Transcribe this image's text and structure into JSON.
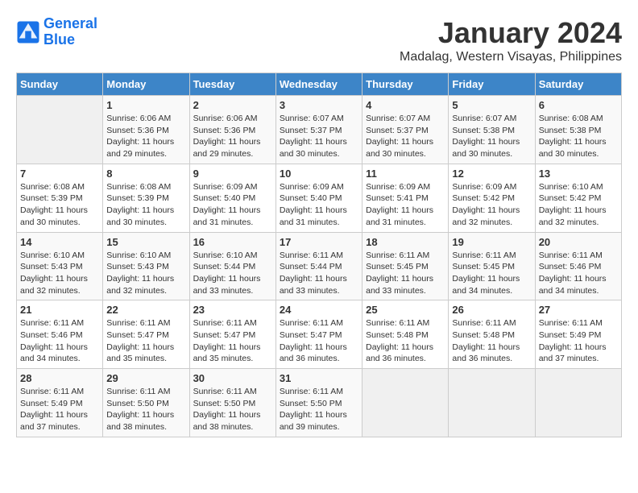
{
  "logo": {
    "line1": "General",
    "line2": "Blue"
  },
  "title": "January 2024",
  "subtitle": "Madalag, Western Visayas, Philippines",
  "days_header": [
    "Sunday",
    "Monday",
    "Tuesday",
    "Wednesday",
    "Thursday",
    "Friday",
    "Saturday"
  ],
  "weeks": [
    [
      {
        "day": "",
        "sunrise": "",
        "sunset": "",
        "daylight": ""
      },
      {
        "day": "1",
        "sunrise": "Sunrise: 6:06 AM",
        "sunset": "Sunset: 5:36 PM",
        "daylight": "Daylight: 11 hours and 29 minutes."
      },
      {
        "day": "2",
        "sunrise": "Sunrise: 6:06 AM",
        "sunset": "Sunset: 5:36 PM",
        "daylight": "Daylight: 11 hours and 29 minutes."
      },
      {
        "day": "3",
        "sunrise": "Sunrise: 6:07 AM",
        "sunset": "Sunset: 5:37 PM",
        "daylight": "Daylight: 11 hours and 30 minutes."
      },
      {
        "day": "4",
        "sunrise": "Sunrise: 6:07 AM",
        "sunset": "Sunset: 5:37 PM",
        "daylight": "Daylight: 11 hours and 30 minutes."
      },
      {
        "day": "5",
        "sunrise": "Sunrise: 6:07 AM",
        "sunset": "Sunset: 5:38 PM",
        "daylight": "Daylight: 11 hours and 30 minutes."
      },
      {
        "day": "6",
        "sunrise": "Sunrise: 6:08 AM",
        "sunset": "Sunset: 5:38 PM",
        "daylight": "Daylight: 11 hours and 30 minutes."
      }
    ],
    [
      {
        "day": "7",
        "sunrise": "Sunrise: 6:08 AM",
        "sunset": "Sunset: 5:39 PM",
        "daylight": "Daylight: 11 hours and 30 minutes."
      },
      {
        "day": "8",
        "sunrise": "Sunrise: 6:08 AM",
        "sunset": "Sunset: 5:39 PM",
        "daylight": "Daylight: 11 hours and 30 minutes."
      },
      {
        "day": "9",
        "sunrise": "Sunrise: 6:09 AM",
        "sunset": "Sunset: 5:40 PM",
        "daylight": "Daylight: 11 hours and 31 minutes."
      },
      {
        "day": "10",
        "sunrise": "Sunrise: 6:09 AM",
        "sunset": "Sunset: 5:40 PM",
        "daylight": "Daylight: 11 hours and 31 minutes."
      },
      {
        "day": "11",
        "sunrise": "Sunrise: 6:09 AM",
        "sunset": "Sunset: 5:41 PM",
        "daylight": "Daylight: 11 hours and 31 minutes."
      },
      {
        "day": "12",
        "sunrise": "Sunrise: 6:09 AM",
        "sunset": "Sunset: 5:42 PM",
        "daylight": "Daylight: 11 hours and 32 minutes."
      },
      {
        "day": "13",
        "sunrise": "Sunrise: 6:10 AM",
        "sunset": "Sunset: 5:42 PM",
        "daylight": "Daylight: 11 hours and 32 minutes."
      }
    ],
    [
      {
        "day": "14",
        "sunrise": "Sunrise: 6:10 AM",
        "sunset": "Sunset: 5:43 PM",
        "daylight": "Daylight: 11 hours and 32 minutes."
      },
      {
        "day": "15",
        "sunrise": "Sunrise: 6:10 AM",
        "sunset": "Sunset: 5:43 PM",
        "daylight": "Daylight: 11 hours and 32 minutes."
      },
      {
        "day": "16",
        "sunrise": "Sunrise: 6:10 AM",
        "sunset": "Sunset: 5:44 PM",
        "daylight": "Daylight: 11 hours and 33 minutes."
      },
      {
        "day": "17",
        "sunrise": "Sunrise: 6:11 AM",
        "sunset": "Sunset: 5:44 PM",
        "daylight": "Daylight: 11 hours and 33 minutes."
      },
      {
        "day": "18",
        "sunrise": "Sunrise: 6:11 AM",
        "sunset": "Sunset: 5:45 PM",
        "daylight": "Daylight: 11 hours and 33 minutes."
      },
      {
        "day": "19",
        "sunrise": "Sunrise: 6:11 AM",
        "sunset": "Sunset: 5:45 PM",
        "daylight": "Daylight: 11 hours and 34 minutes."
      },
      {
        "day": "20",
        "sunrise": "Sunrise: 6:11 AM",
        "sunset": "Sunset: 5:46 PM",
        "daylight": "Daylight: 11 hours and 34 minutes."
      }
    ],
    [
      {
        "day": "21",
        "sunrise": "Sunrise: 6:11 AM",
        "sunset": "Sunset: 5:46 PM",
        "daylight": "Daylight: 11 hours and 34 minutes."
      },
      {
        "day": "22",
        "sunrise": "Sunrise: 6:11 AM",
        "sunset": "Sunset: 5:47 PM",
        "daylight": "Daylight: 11 hours and 35 minutes."
      },
      {
        "day": "23",
        "sunrise": "Sunrise: 6:11 AM",
        "sunset": "Sunset: 5:47 PM",
        "daylight": "Daylight: 11 hours and 35 minutes."
      },
      {
        "day": "24",
        "sunrise": "Sunrise: 6:11 AM",
        "sunset": "Sunset: 5:47 PM",
        "daylight": "Daylight: 11 hours and 36 minutes."
      },
      {
        "day": "25",
        "sunrise": "Sunrise: 6:11 AM",
        "sunset": "Sunset: 5:48 PM",
        "daylight": "Daylight: 11 hours and 36 minutes."
      },
      {
        "day": "26",
        "sunrise": "Sunrise: 6:11 AM",
        "sunset": "Sunset: 5:48 PM",
        "daylight": "Daylight: 11 hours and 36 minutes."
      },
      {
        "day": "27",
        "sunrise": "Sunrise: 6:11 AM",
        "sunset": "Sunset: 5:49 PM",
        "daylight": "Daylight: 11 hours and 37 minutes."
      }
    ],
    [
      {
        "day": "28",
        "sunrise": "Sunrise: 6:11 AM",
        "sunset": "Sunset: 5:49 PM",
        "daylight": "Daylight: 11 hours and 37 minutes."
      },
      {
        "day": "29",
        "sunrise": "Sunrise: 6:11 AM",
        "sunset": "Sunset: 5:50 PM",
        "daylight": "Daylight: 11 hours and 38 minutes."
      },
      {
        "day": "30",
        "sunrise": "Sunrise: 6:11 AM",
        "sunset": "Sunset: 5:50 PM",
        "daylight": "Daylight: 11 hours and 38 minutes."
      },
      {
        "day": "31",
        "sunrise": "Sunrise: 6:11 AM",
        "sunset": "Sunset: 5:50 PM",
        "daylight": "Daylight: 11 hours and 39 minutes."
      },
      {
        "day": "",
        "sunrise": "",
        "sunset": "",
        "daylight": ""
      },
      {
        "day": "",
        "sunrise": "",
        "sunset": "",
        "daylight": ""
      },
      {
        "day": "",
        "sunrise": "",
        "sunset": "",
        "daylight": ""
      }
    ]
  ]
}
